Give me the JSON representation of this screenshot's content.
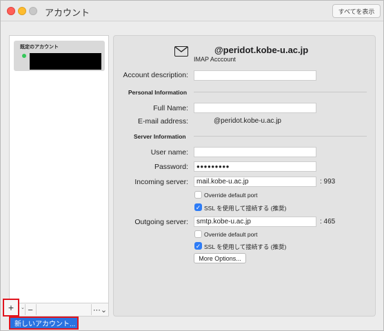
{
  "window": {
    "title": "アカウント",
    "show_all_label": "すべてを表示"
  },
  "sidebar": {
    "account": {
      "label": "既定のアカウント",
      "status_color": "#35c759"
    },
    "toolbar": {
      "add_icon": "plus-icon",
      "add_label": "+",
      "caret_label": "⌄",
      "remove_label": "−",
      "action_label": "⋯⌄"
    }
  },
  "popup_menu": {
    "new_account_label": "新しいアカウント..."
  },
  "account": {
    "email": "@peridot.kobe-u.ac.jp",
    "type": "IMAP Acccount",
    "icon": "envelope-icon"
  },
  "form": {
    "account_description": {
      "label": "Account description:",
      "value": ""
    },
    "personal_section": "Personal Information",
    "full_name": {
      "label": "Full Name:",
      "value": ""
    },
    "email_address": {
      "label": "E-mail address:",
      "value": "@peridot.kobe-u.ac.jp"
    },
    "server_section": "Server Information",
    "user_name": {
      "label": "User name:",
      "value": ""
    },
    "password": {
      "label": "Password:",
      "value": "●●●●●●●●●"
    },
    "incoming_server": {
      "label": "Incoming server:",
      "value": "mail.kobe-u.ac.jp",
      "port": ": 993"
    },
    "incoming_override": {
      "label": "Override default port",
      "checked": false
    },
    "incoming_ssl": {
      "label": "SSL を使用して接続する (推奨)",
      "checked": true
    },
    "outgoing_server": {
      "label": "Outgoing server:",
      "value": "smtp.kobe-u.ac.jp",
      "port": ": 465"
    },
    "outgoing_override": {
      "label": "Override default port",
      "checked": false
    },
    "outgoing_ssl": {
      "label": "SSL を使用して接続する (推奨)",
      "checked": true
    },
    "more_options_label": "More Options..."
  },
  "colors": {
    "highlight_red": "#e0141e",
    "menu_selection_blue": "#2a72e0",
    "checkbox_blue": "#2e7cf6"
  }
}
